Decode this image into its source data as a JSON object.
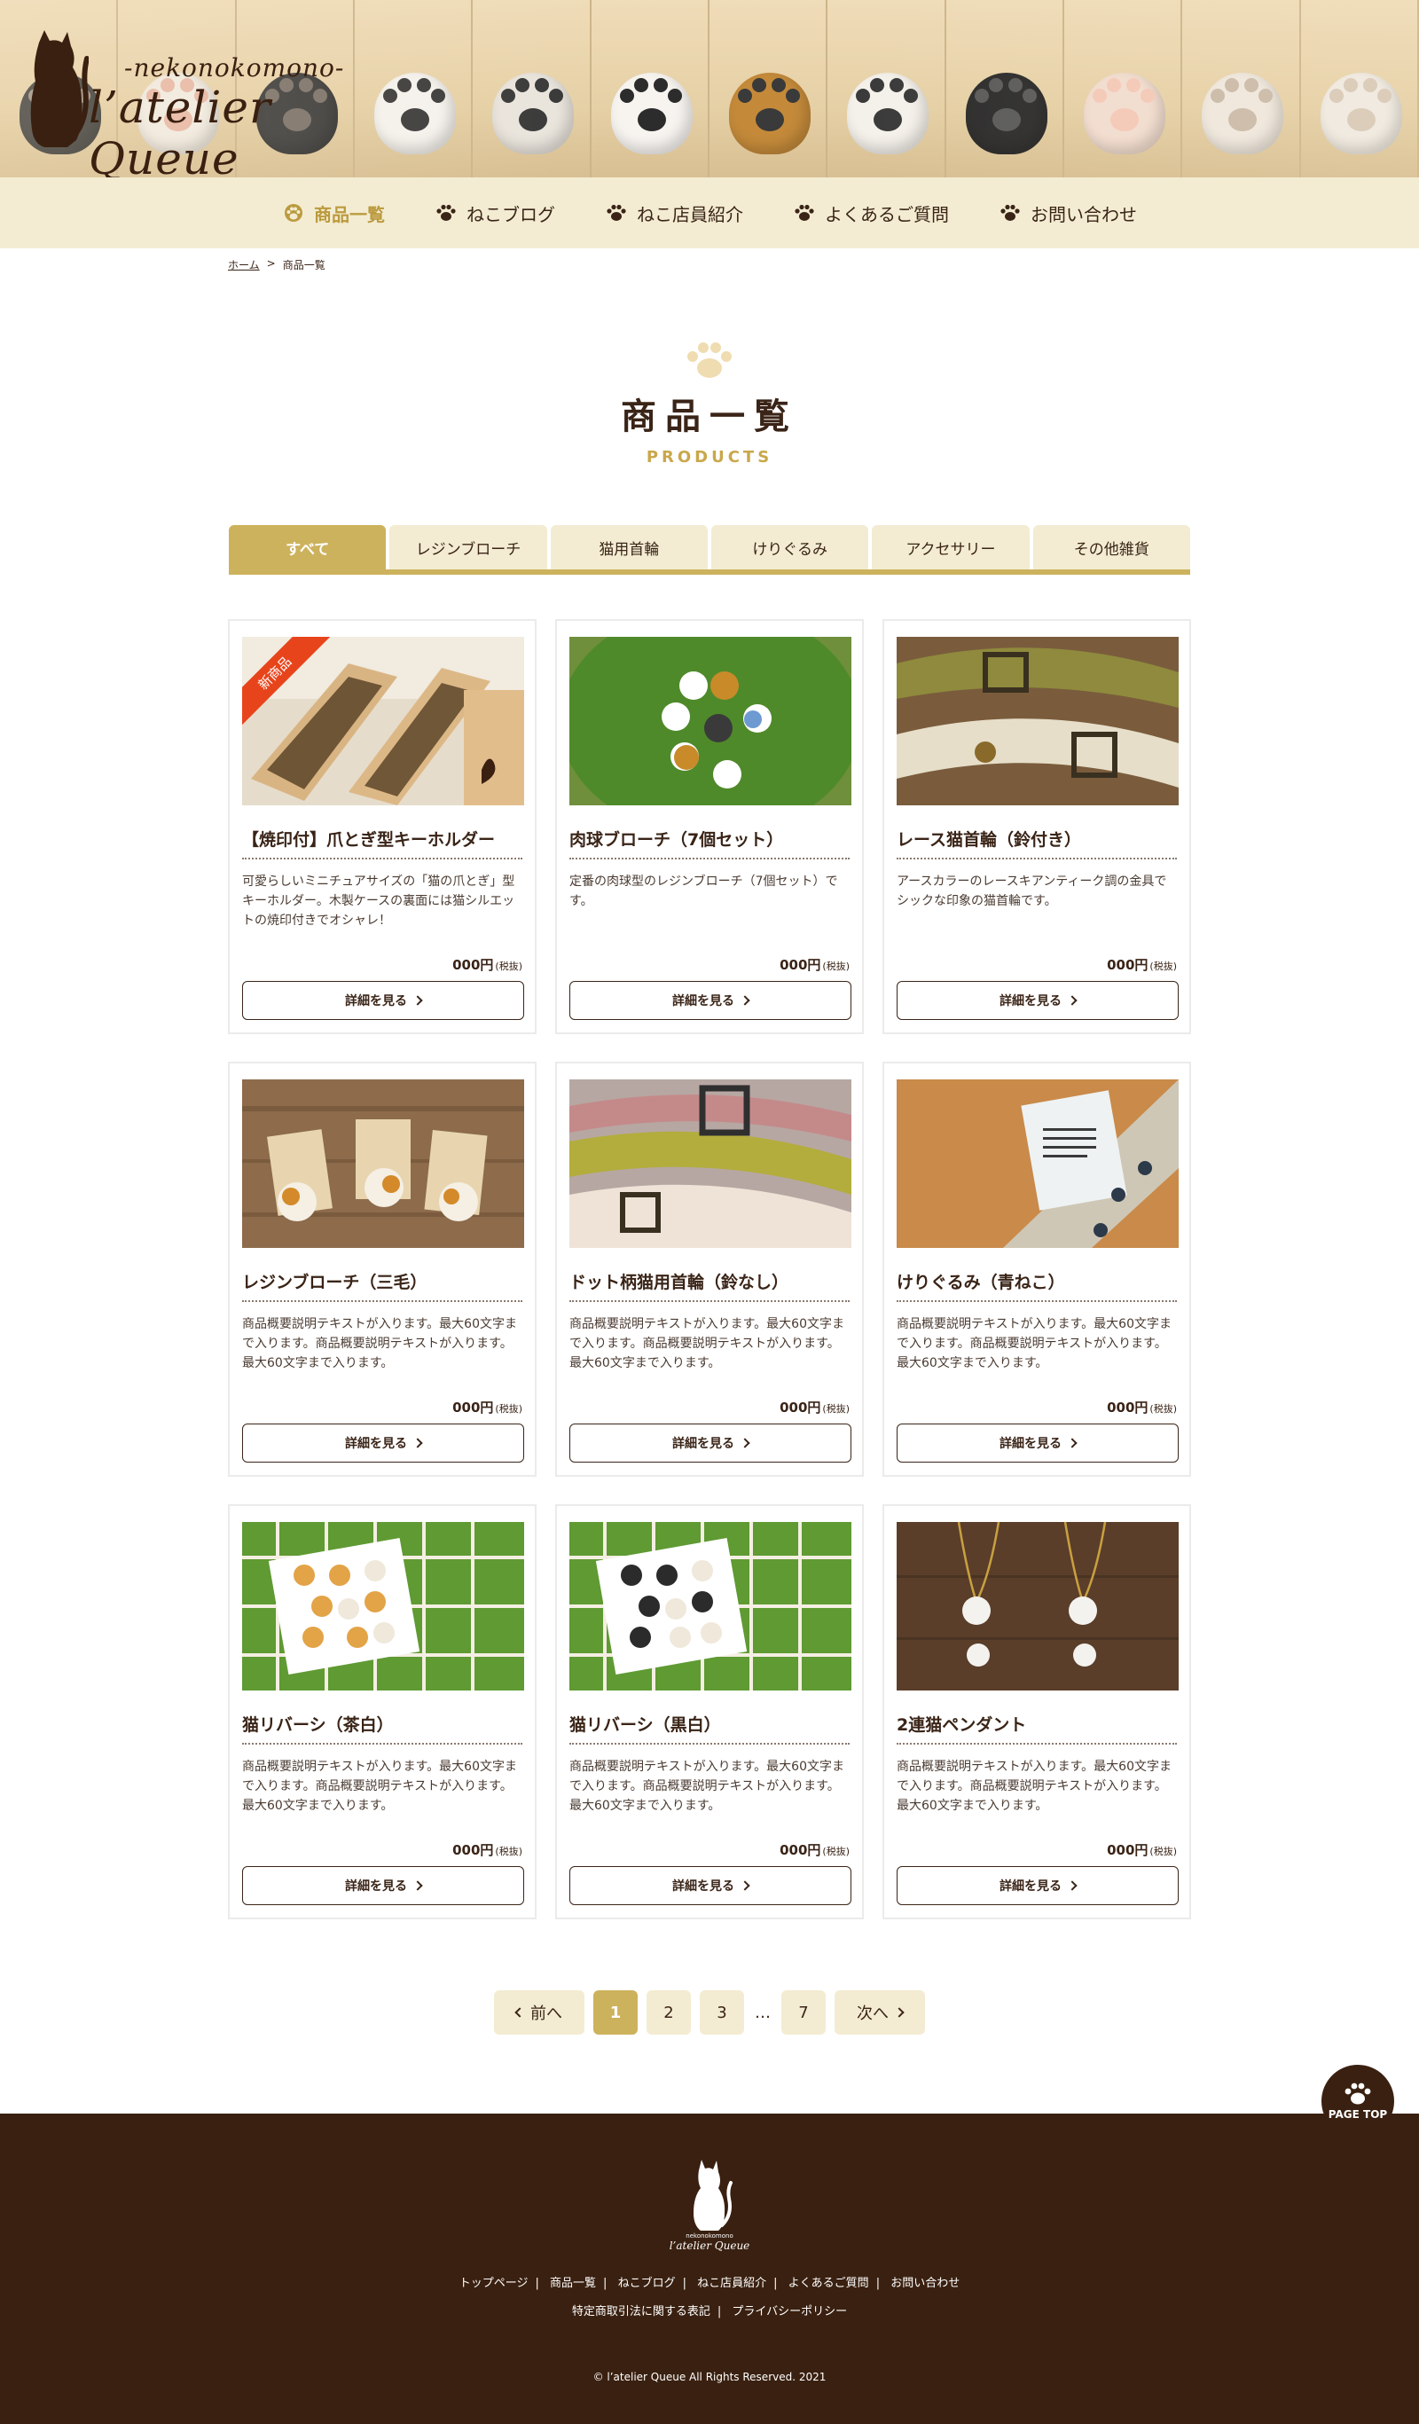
{
  "brand": {
    "subtitle": "-nekonokomono-",
    "name": "l’atelier Queue"
  },
  "nav": [
    {
      "label": "商品一覧",
      "active": true
    },
    {
      "label": "ねこブログ"
    },
    {
      "label": "ねこ店員紹介"
    },
    {
      "label": "よくあるご質問"
    },
    {
      "label": "お問い合わせ"
    }
  ],
  "breadcrumb": {
    "home": "ホーム",
    "sep": ">",
    "current": "商品一覧"
  },
  "page": {
    "title": "商品一覧",
    "subtitle": "PRODUCTS"
  },
  "tabs": [
    "すべて",
    "レジンブローチ",
    "猫用首輪",
    "けりぐるみ",
    "アクセサリー",
    "その他雑貨"
  ],
  "products": [
    {
      "badge": "新商品",
      "name": "【焼印付】爪とぎ型キーホルダー",
      "desc": "可愛らしいミニチュアサイズの「猫の爪とぎ」型キーホルダー。木製ケースの裏面には猫シルエットの焼印付きでオシャレ！",
      "price": "000円",
      "tax": "(税抜)",
      "button": "詳細を見る"
    },
    {
      "name": "肉球ブローチ（7個セット）",
      "desc": "定番の肉球型のレジンブローチ（7個セット）です。",
      "price": "000円",
      "tax": "(税抜)",
      "button": "詳細を見る"
    },
    {
      "name": "レース猫首輪（鈴付き）",
      "desc": "アースカラーのレースキアンティーク調の金具でシックな印象の猫首輪です。",
      "price": "000円",
      "tax": "(税抜)",
      "button": "詳細を見る"
    },
    {
      "name": "レジンブローチ（三毛）",
      "desc": "商品概要説明テキストが入ります。最大60文字まで入ります。商品概要説明テキストが入ります。最大60文字まで入ります。",
      "price": "000円",
      "tax": "(税抜)",
      "button": "詳細を見る"
    },
    {
      "name": "ドット柄猫用首輪（鈴なし）",
      "desc": "商品概要説明テキストが入ります。最大60文字まで入ります。商品概要説明テキストが入ります。最大60文字まで入ります。",
      "price": "000円",
      "tax": "(税抜)",
      "button": "詳細を見る"
    },
    {
      "name": "けりぐるみ（青ねこ）",
      "desc": "商品概要説明テキストが入ります。最大60文字まで入ります。商品概要説明テキストが入ります。最大60文字まで入ります。",
      "price": "000円",
      "tax": "(税抜)",
      "button": "詳細を見る"
    },
    {
      "name": "猫リバーシ（茶白）",
      "desc": "商品概要説明テキストが入ります。最大60文字まで入ります。商品概要説明テキストが入ります。最大60文字まで入ります。",
      "price": "000円",
      "tax": "(税抜)",
      "button": "詳細を見る"
    },
    {
      "name": "猫リバーシ（黒白）",
      "desc": "商品概要説明テキストが入ります。最大60文字まで入ります。商品概要説明テキストが入ります。最大60文字まで入ります。",
      "price": "000円",
      "tax": "(税抜)",
      "button": "詳細を見る"
    },
    {
      "name": "2連猫ペンダント",
      "desc": "商品概要説明テキストが入ります。最大60文字まで入ります。商品概要説明テキストが入ります。最大60文字まで入ります。",
      "price": "000円",
      "tax": "(税抜)",
      "button": "詳細を見る"
    }
  ],
  "pagination": {
    "prev": "前へ",
    "pages": [
      "1",
      "2",
      "3"
    ],
    "ellipsis": "…",
    "last": "7",
    "next": "次へ",
    "current": "1"
  },
  "page_top": "PAGE TOP",
  "footer": {
    "logo_sub": "nekonokomono",
    "logo_name": "l’atelier Queue",
    "links": [
      "トップページ",
      "商品一覧",
      "ねこブログ",
      "ねこ店員紹介",
      "よくあるご質問",
      "お問い合わせ"
    ],
    "links2": [
      "特定商取引法に関する表記",
      "プライバシーポリシー"
    ],
    "copyright": "© l’atelier Queue All Rights Reserved. 2021"
  },
  "colors": {
    "accent": "#cdb25d",
    "brown": "#3a2010",
    "cream": "#f3ecd2",
    "badge": "#e8441b"
  }
}
